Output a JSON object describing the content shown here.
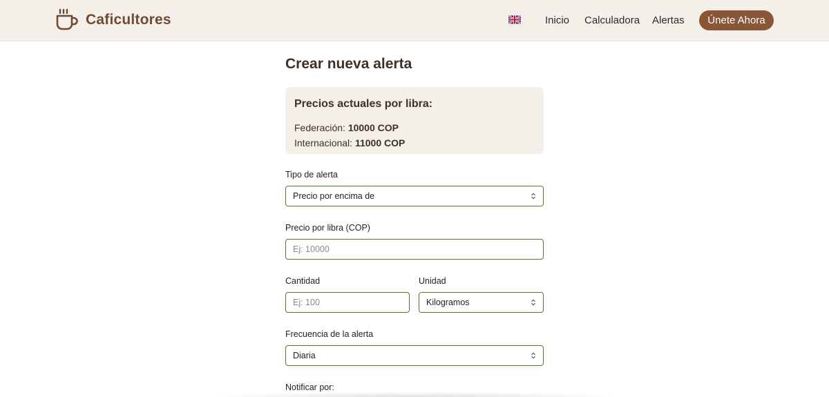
{
  "header": {
    "brand_name": "Caficultores",
    "brand_icon": "coffee-cup-icon",
    "language_icon": "uk-flag-icon",
    "nav": [
      {
        "label": "Inicio"
      },
      {
        "label": "Calculadora"
      },
      {
        "label": "Alertas"
      }
    ],
    "cta_label": "Únete Ahora"
  },
  "page": {
    "title": "Crear nueva alerta"
  },
  "prices": {
    "title": "Precios actuales por libra:",
    "federation_label": "Federación:",
    "federation_value": "10000 COP",
    "international_label": "Internacional:",
    "international_value": "11000 COP"
  },
  "form": {
    "alert_type": {
      "label": "Tipo de alerta",
      "value": "Precio por encima de"
    },
    "price": {
      "label": "Precio por libra (COP)",
      "value": "",
      "placeholder": "Ej: 10000"
    },
    "quantity": {
      "label": "Cantidad",
      "value": "",
      "placeholder": "Ej: 100"
    },
    "unit": {
      "label": "Unidad",
      "value": "Kilogramos"
    },
    "frequency": {
      "label": "Frecuencia de la alerta",
      "value": "Diaria"
    },
    "notify": {
      "label": "Notificar por:"
    }
  },
  "colors": {
    "header_bg": "#f4efe8",
    "brand": "#6f4a33",
    "cta": "#8a5638",
    "field_border": "#4b7a32"
  }
}
